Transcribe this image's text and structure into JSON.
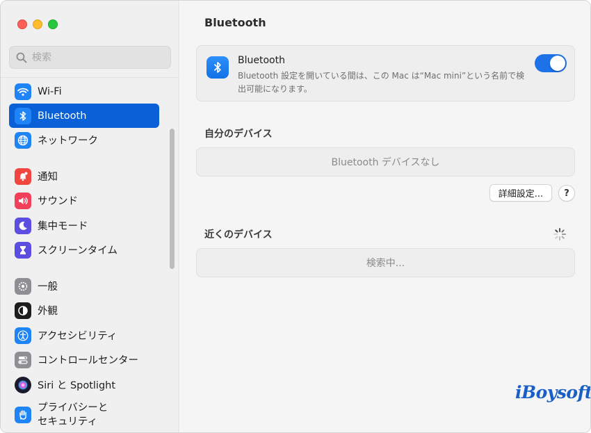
{
  "sidebar": {
    "search_placeholder": "検索",
    "items": [
      {
        "label": "Wi-Fi",
        "icon": "wifi-icon",
        "color": "#1f84f5"
      },
      {
        "label": "Bluetooth",
        "icon": "bluetooth-icon",
        "color": "#1f84f5",
        "selected": true
      },
      {
        "label": "ネットワーク",
        "icon": "globe-icon",
        "color": "#1f84f5"
      },
      {
        "label": "通知",
        "icon": "bell-icon",
        "color": "#f0463f"
      },
      {
        "label": "サウンド",
        "icon": "speaker-icon",
        "color": "#f0405a"
      },
      {
        "label": "集中モード",
        "icon": "moon-icon",
        "color": "#5b4ee0"
      },
      {
        "label": "スクリーンタイム",
        "icon": "hourglass-icon",
        "color": "#5b4ee0"
      },
      {
        "label": "一般",
        "icon": "gear-icon",
        "color": "#8e8e93"
      },
      {
        "label": "外観",
        "icon": "appearance-icon",
        "color": "#1d1d1f"
      },
      {
        "label": "アクセシビリティ",
        "icon": "accessibility-icon",
        "color": "#1f84f5"
      },
      {
        "label": "コントロールセンター",
        "icon": "control-center-icon",
        "color": "#8e8e93"
      },
      {
        "label": "Siri と Spotlight",
        "icon": "siri-icon",
        "color": "#3a2f7a"
      },
      {
        "label": "プライバシーと\nセキュリティ",
        "icon": "hand-icon",
        "color": "#1f84f5"
      }
    ]
  },
  "main": {
    "title": "Bluetooth",
    "bluetooth_card": {
      "name": "Bluetooth",
      "description": "Bluetooth 設定を開いている間は、この Mac は“Mac mini”という名前で検出可能になります。",
      "toggle_on": true
    },
    "my_devices": {
      "title": "自分のデバイス",
      "empty_text": "Bluetooth デバイスなし"
    },
    "advanced_button": "詳細設定...",
    "help_button": "?",
    "nearby_devices": {
      "title": "近くのデバイス",
      "status_text": "検索中..."
    },
    "watermark": "iBoysoft"
  },
  "colors": {
    "accent": "#0a60d6",
    "toggle": "#1d72e8"
  }
}
